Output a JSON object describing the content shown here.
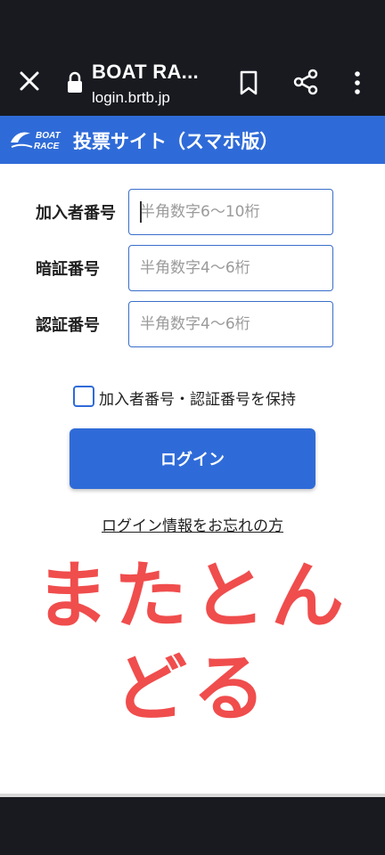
{
  "browser": {
    "title": "BOAT RA...",
    "url": "login.brtb.jp"
  },
  "header": {
    "title": "投票サイト（スマホ版）",
    "logo_text_line1": "BOAT",
    "logo_text_line2": "RACE"
  },
  "form": {
    "member_number": {
      "label": "加入者番号",
      "placeholder": "半角数字6〜10桁"
    },
    "pin": {
      "label": "暗証番号",
      "placeholder": "半角数字4〜6桁"
    },
    "auth_number": {
      "label": "認証番号",
      "placeholder": "半角数字4〜6桁"
    }
  },
  "remember": {
    "label": "加入者番号・認証番号を保持",
    "checked": false
  },
  "login_button": {
    "label": "ログイン"
  },
  "forgot_link": {
    "label": "ログイン情報をお忘れの方"
  },
  "overlay": {
    "text": "またとんどる"
  },
  "colors": {
    "brand_blue": "#2f6bd8",
    "overlay_red": "#f04d4d",
    "chrome_dark": "#181a20"
  }
}
